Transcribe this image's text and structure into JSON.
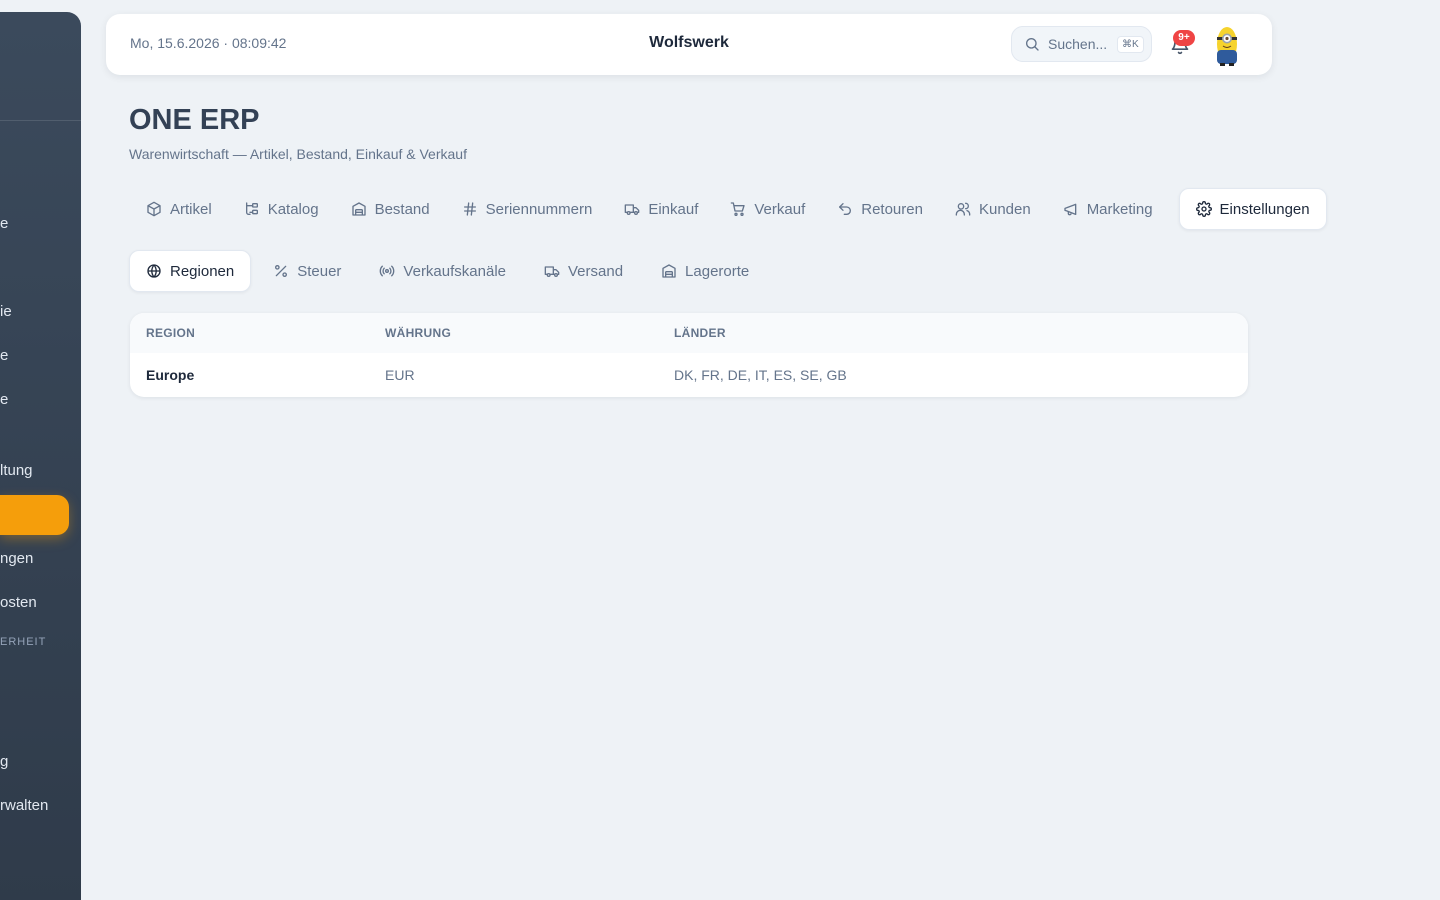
{
  "sidebar": {
    "items": [
      {
        "label": "e"
      },
      {
        "label": "ie"
      },
      {
        "label": "e"
      },
      {
        "label": "e"
      },
      {
        "label": "ltung"
      },
      {
        "label": ""
      },
      {
        "label": "ngen"
      },
      {
        "label": "osten"
      },
      {
        "label": "ERHEIT"
      },
      {
        "label": "g"
      },
      {
        "label": "rwalten"
      }
    ],
    "accent_color": "#f59e0b"
  },
  "header": {
    "datetime": "Mo, 15.6.2026 · 08:09:42",
    "company": "Wolfswerk",
    "search_placeholder": "Suchen...",
    "search_shortcut": "⌘K",
    "notification_badge": "9+"
  },
  "page": {
    "title": "ONE ERP",
    "subtitle": "Warenwirtschaft — Artikel, Bestand, Einkauf & Verkauf"
  },
  "tabs": [
    {
      "label": "Artikel",
      "icon": "box-icon"
    },
    {
      "label": "Katalog",
      "icon": "catalog-icon"
    },
    {
      "label": "Bestand",
      "icon": "warehouse-icon"
    },
    {
      "label": "Seriennummern",
      "icon": "hash-icon"
    },
    {
      "label": "Einkauf",
      "icon": "truck-icon"
    },
    {
      "label": "Verkauf",
      "icon": "cart-icon"
    },
    {
      "label": "Retouren",
      "icon": "undo-icon"
    },
    {
      "label": "Kunden",
      "icon": "users-icon"
    },
    {
      "label": "Marketing",
      "icon": "megaphone-icon"
    },
    {
      "label": "Einstellungen",
      "icon": "gear-icon",
      "active": true
    }
  ],
  "subtabs": [
    {
      "label": "Regionen",
      "icon": "globe-icon",
      "active": true
    },
    {
      "label": "Steuer",
      "icon": "percent-icon"
    },
    {
      "label": "Verkaufskanäle",
      "icon": "broadcast-icon"
    },
    {
      "label": "Versand",
      "icon": "truck-icon"
    },
    {
      "label": "Lagerorte",
      "icon": "warehouse-icon"
    }
  ],
  "table": {
    "columns": [
      "REGION",
      "WÄHRUNG",
      "LÄNDER"
    ],
    "rows": [
      {
        "region": "Europe",
        "currency": "EUR",
        "countries": "DK, FR, DE, IT, ES, SE, GB"
      }
    ]
  }
}
